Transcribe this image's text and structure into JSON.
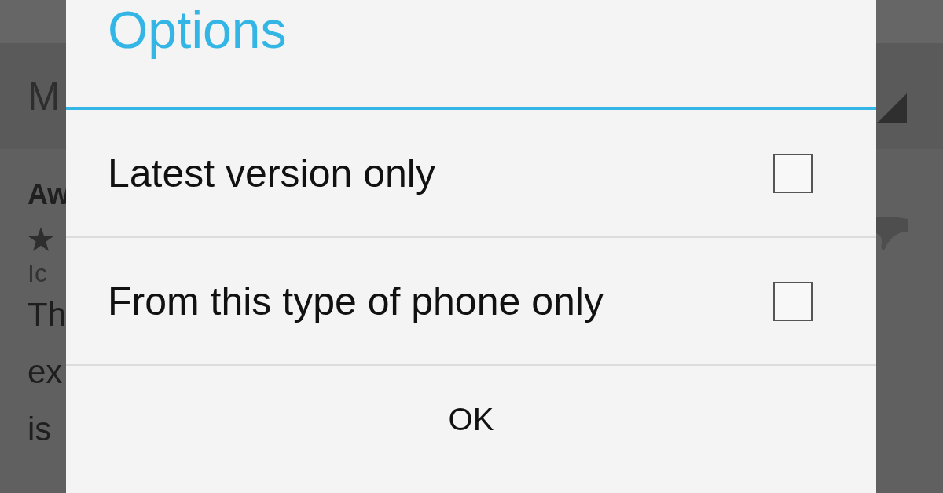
{
  "background": {
    "header_title": "M",
    "review": {
      "title": "Aw",
      "author": "Ic",
      "body_lines": [
        "Th",
        "ex",
        "is"
      ]
    }
  },
  "dialog": {
    "title": "Options",
    "options": [
      {
        "label": "Latest version only",
        "checked": false
      },
      {
        "label": "From this type of phone only",
        "checked": false
      }
    ],
    "button": "OK"
  }
}
